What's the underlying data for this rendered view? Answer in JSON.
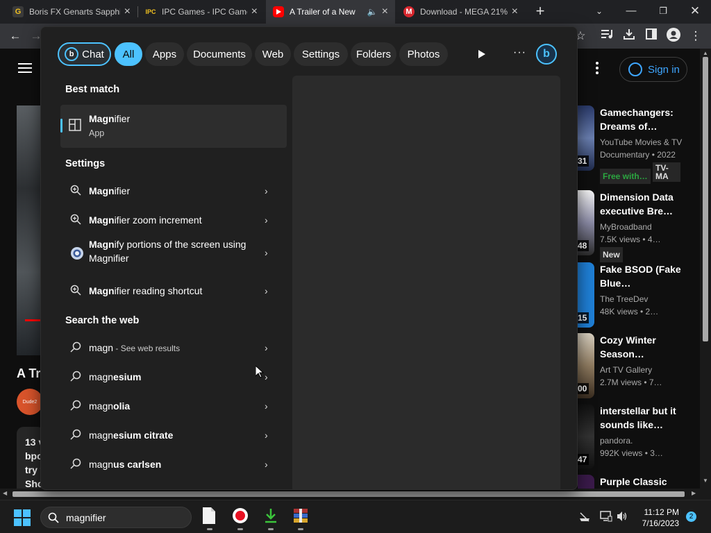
{
  "browser": {
    "tabs": [
      {
        "title": "Boris FX Genarts Sapphi",
        "favicon": "G"
      },
      {
        "title": "IPC Games - IPC Game",
        "favicon": "IPC"
      },
      {
        "title": "A Trailer of a New",
        "favicon": "yt"
      },
      {
        "title": "Download - MEGA 21%",
        "favicon": "M"
      }
    ]
  },
  "youtube": {
    "sign_in": "Sign in",
    "main_title": "A Tr",
    "avatar_text": "Dude2",
    "desc_line1": "13 v",
    "desc_line2": "bpo",
    "desc_line3": "try t",
    "desc_line4": "Sho",
    "recommendations": [
      {
        "title": "Gamechangers: Dreams of…",
        "channel": "YouTube Movies & TV",
        "meta": "Documentary • 2022",
        "badge": "Free with…",
        "badge2": "TV-MA",
        "duration": "31"
      },
      {
        "title": "Dimension Data executive Bre…",
        "channel": "MyBroadband",
        "meta": "7.5K views • 4…",
        "badge": "New",
        "duration": "48"
      },
      {
        "title": "Fake BSOD (Fake Blue…",
        "channel": "The TreeDev",
        "meta": "48K views • 2…",
        "duration": "15"
      },
      {
        "title": "Cozy Winter Season…",
        "channel": "Art TV Gallery",
        "meta": "2.7M views • 7…",
        "duration": "00"
      },
      {
        "title": "interstellar but it sounds like…",
        "channel": "pandora.",
        "meta": "992K views • 3…",
        "duration": "47"
      },
      {
        "title": "Purple Classic",
        "channel": "",
        "meta": "",
        "duration": ""
      }
    ]
  },
  "search": {
    "chips": [
      "Chat",
      "All",
      "Apps",
      "Documents",
      "Web",
      "Settings",
      "Folders",
      "Photos"
    ],
    "best_match_heading": "Best match",
    "best_match": {
      "name_bold": "Magn",
      "name_rest": "ifier",
      "type": "App"
    },
    "settings_heading": "Settings",
    "settings": [
      {
        "bold": "Magn",
        "rest": "ifier"
      },
      {
        "bold": "Magn",
        "rest": "ifier zoom increment"
      },
      {
        "bold": "Magn",
        "rest": "ify portions of the screen using Magnifier"
      },
      {
        "bold": "Magn",
        "rest": "ifier reading shortcut"
      }
    ],
    "web_heading": "Search the web",
    "web": [
      {
        "plain": "magn",
        "suffix": " - See web results"
      },
      {
        "plain": "magn",
        "bold": "esium"
      },
      {
        "plain": "magn",
        "bold": "olia"
      },
      {
        "plain": "magn",
        "bold": "esium citrate"
      },
      {
        "plain": "magn",
        "bold": "us carlsen"
      }
    ]
  },
  "taskbar": {
    "search_text": "magnifier",
    "time": "11:12 PM",
    "date": "7/16/2023",
    "notifications": "2"
  },
  "colors": {
    "accent": "#4cc2ff",
    "youtube_red": "#ff0000",
    "panel_bg": "#202020"
  }
}
